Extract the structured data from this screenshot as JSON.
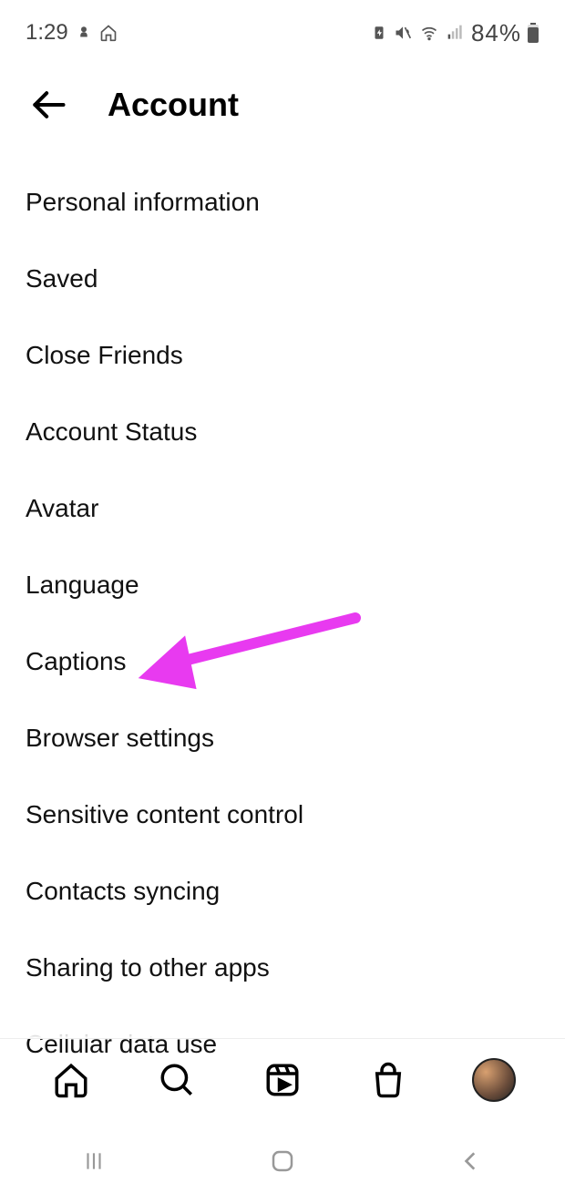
{
  "status": {
    "time": "1:29",
    "battery": "84%"
  },
  "header": {
    "title": "Account"
  },
  "menu": {
    "items": [
      "Personal information",
      "Saved",
      "Close Friends",
      "Account Status",
      "Avatar",
      "Language",
      "Captions",
      "Browser settings",
      "Sensitive content control",
      "Contacts syncing",
      "Sharing to other apps",
      "Cellular data use"
    ]
  },
  "annotation": {
    "target": "Captions",
    "color": "#e83af0"
  }
}
